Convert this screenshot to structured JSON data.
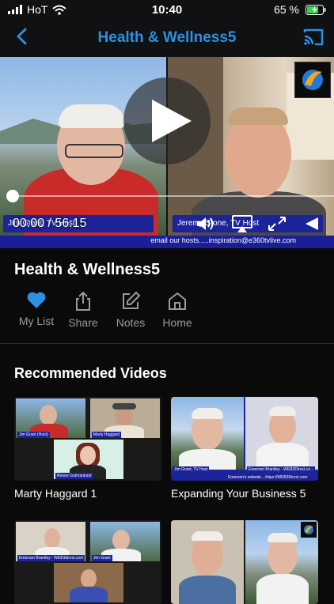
{
  "status_bar": {
    "carrier": "HoT",
    "time": "10:40",
    "battery": "65 %"
  },
  "nav": {
    "title": "Health & Wellness5",
    "back_icon": "chevron-left-icon",
    "cast_icon": "cast-icon"
  },
  "player": {
    "left_name": "Jim Grant, TV Host",
    "right_name": "Jeremy Stone, TV Host",
    "email_banner": "email our hosts.....inspiration@e360tvlive.com",
    "timecode": "00:00 / 56:15",
    "progress": 0.0
  },
  "video": {
    "title": "Health & Wellness5"
  },
  "actions": [
    {
      "label": "My List",
      "icon": "heart-icon",
      "active": true
    },
    {
      "label": "Share",
      "icon": "share-icon",
      "active": false
    },
    {
      "label": "Notes",
      "icon": "edit-icon",
      "active": false
    },
    {
      "label": "Home",
      "icon": "home-icon",
      "active": false
    }
  ],
  "recommended": {
    "title": "Recommended Videos",
    "items": [
      {
        "label": "Marty Haggard 1",
        "tags": [
          "Jim Grant (Host)",
          "Marty Haggard",
          "Renee Gutmanlund"
        ]
      },
      {
        "label": "Expanding Your Business 5",
        "tags": [
          "Jim Grant, TV Host",
          "Emerson Brantley - WEB3Direct.co...",
          "Emerson's website....https://WEB3Direct.com"
        ]
      },
      {
        "label": "",
        "tags": [
          "Emerson Brantley - WEB3direct.com",
          "Jim Grant"
        ]
      },
      {
        "label": "",
        "tags": []
      }
    ]
  },
  "colors": {
    "accent": "#2d8fe0",
    "background": "#0a0a0b",
    "lower_third": "#1d2399"
  }
}
